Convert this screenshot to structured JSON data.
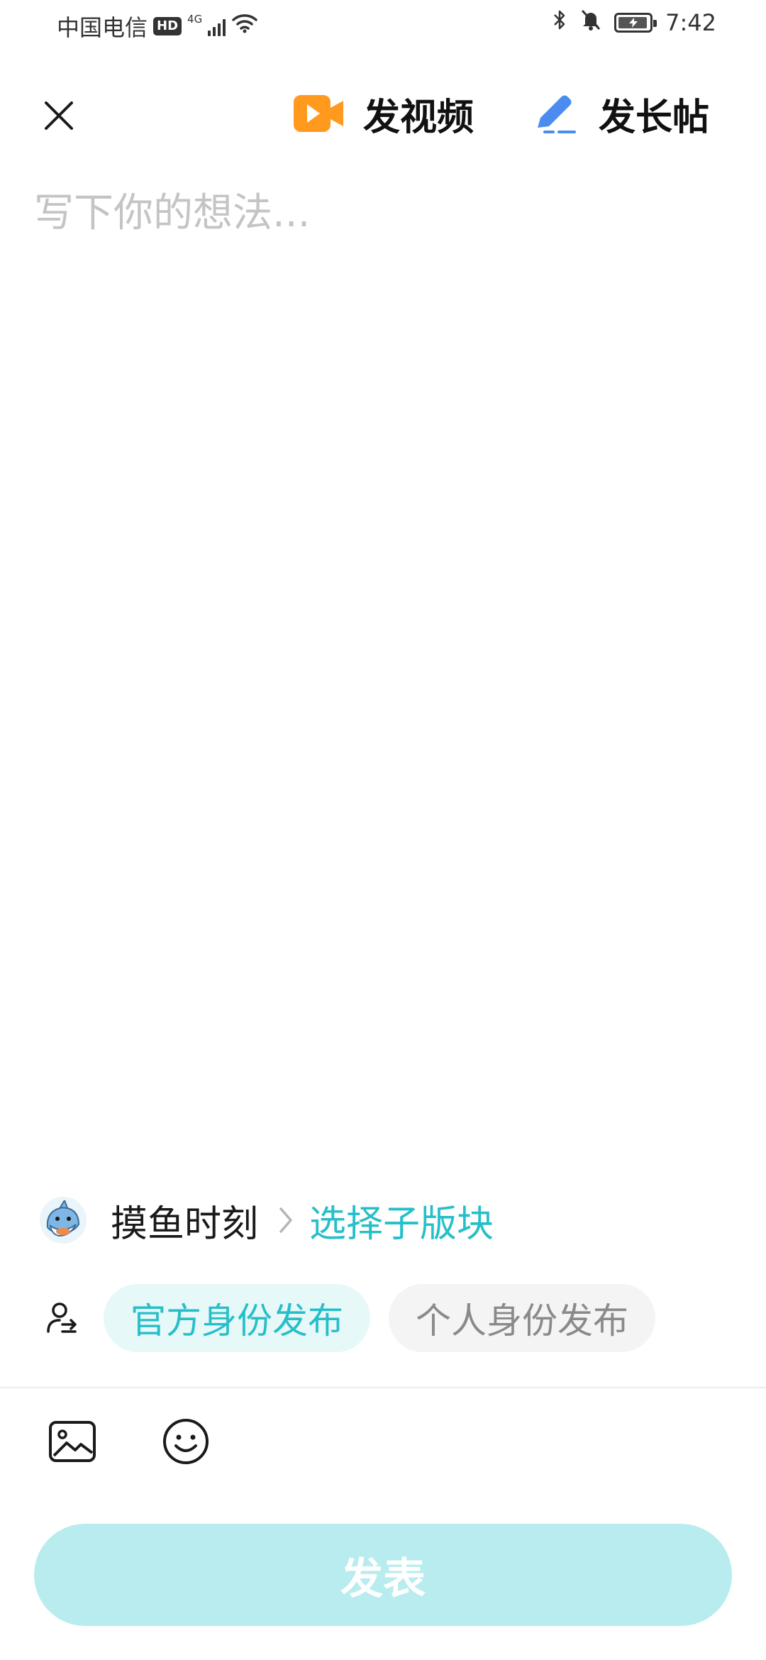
{
  "status_bar": {
    "carrier": "中国电信",
    "hd": "HD",
    "network": "4G",
    "time": "7:42"
  },
  "header": {
    "close_icon": "close-icon",
    "video_label": "发视频",
    "long_post_label": "发长帖",
    "video_icon_color": "#FF9A1F",
    "long_post_icon_color": "#4A8CF0"
  },
  "composer": {
    "placeholder": "写下你的想法...",
    "value": ""
  },
  "board": {
    "name": "摸鱼时刻",
    "select_label": "选择子版块",
    "accent": "#26BFC9"
  },
  "identity": {
    "official_label": "官方身份发布",
    "personal_label": "个人身份发布",
    "selected": "official"
  },
  "toolbar": {
    "image_icon": "image-icon",
    "emoji_icon": "emoji-icon"
  },
  "publish": {
    "label": "发表",
    "disabled_color": "#B8ECEE"
  }
}
